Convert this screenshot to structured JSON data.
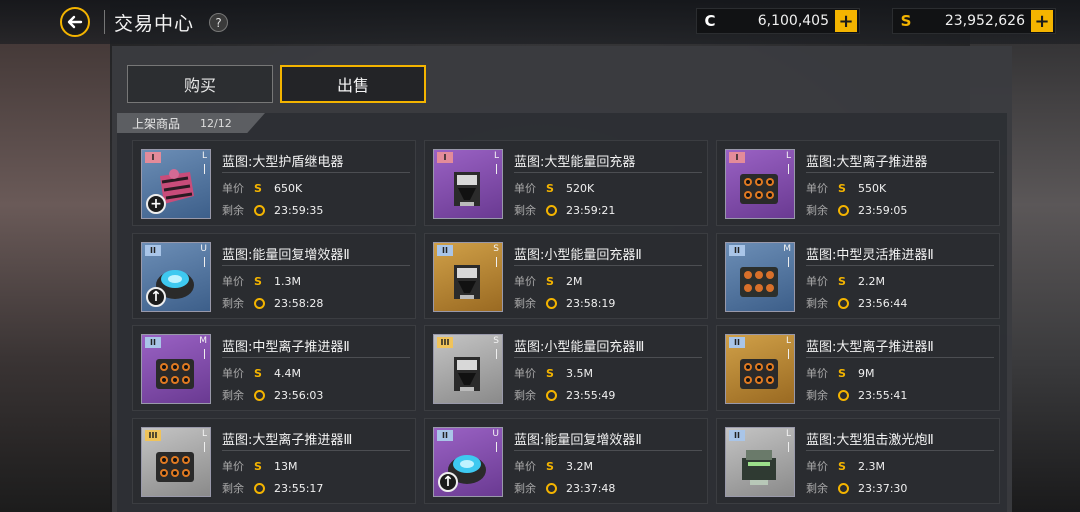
{
  "header": {
    "title": "交易中心",
    "help": "?",
    "currency_c": {
      "symbol": "C",
      "value": "6,100,405",
      "plus": "+"
    },
    "currency_s": {
      "symbol": "S",
      "value": "23,952,626",
      "plus": "+"
    }
  },
  "tabs": {
    "buy": "购买",
    "sell": "出售",
    "active": "sell"
  },
  "listing": {
    "title": "上架商品",
    "count": "12/12"
  },
  "labels": {
    "price": "单价",
    "remaining": "剩余",
    "coin": "S"
  },
  "colors": {
    "accent": "#f4b400"
  },
  "items": [
    {
      "name": "蓝图:大型护盾继电器",
      "price": "650K",
      "time": "23:59:35",
      "tier": "I",
      "slot": "L",
      "rarity": "blue",
      "badge": "+",
      "icon": "shield-relay-icon"
    },
    {
      "name": "蓝图:大型能量回充器",
      "price": "520K",
      "time": "23:59:21",
      "tier": "I",
      "slot": "L",
      "rarity": "purple",
      "badge": "",
      "icon": "energy-recharger-icon"
    },
    {
      "name": "蓝图:大型离子推进器",
      "price": "550K",
      "time": "23:59:05",
      "tier": "I",
      "slot": "L",
      "rarity": "purple",
      "badge": "",
      "icon": "ion-thruster-icon"
    },
    {
      "name": "蓝图:能量回复增效器Ⅱ",
      "price": "1.3M",
      "time": "23:58:28",
      "tier": "II",
      "slot": "U",
      "rarity": "blue",
      "badge": "↑",
      "icon": "energy-booster-icon"
    },
    {
      "name": "蓝图:小型能量回充器Ⅱ",
      "price": "2M",
      "time": "23:58:19",
      "tier": "II",
      "slot": "S",
      "rarity": "orange",
      "badge": "",
      "icon": "energy-recharger-icon"
    },
    {
      "name": "蓝图:中型灵活推进器Ⅱ",
      "price": "2.2M",
      "time": "23:56:44",
      "tier": "II",
      "slot": "M",
      "rarity": "blue",
      "badge": "",
      "icon": "agile-thruster-icon"
    },
    {
      "name": "蓝图:中型离子推进器Ⅱ",
      "price": "4.4M",
      "time": "23:56:03",
      "tier": "II",
      "slot": "M",
      "rarity": "purple",
      "badge": "",
      "icon": "ion-thruster-icon"
    },
    {
      "name": "蓝图:小型能量回充器Ⅲ",
      "price": "3.5M",
      "time": "23:55:49",
      "tier": "III",
      "slot": "S",
      "rarity": "grey",
      "badge": "",
      "icon": "energy-recharger-icon"
    },
    {
      "name": "蓝图:大型离子推进器Ⅱ",
      "price": "9M",
      "time": "23:55:41",
      "tier": "II",
      "slot": "L",
      "rarity": "orange",
      "badge": "",
      "icon": "ion-thruster-icon"
    },
    {
      "name": "蓝图:大型离子推进器Ⅲ",
      "price": "13M",
      "time": "23:55:17",
      "tier": "III",
      "slot": "L",
      "rarity": "grey",
      "badge": "",
      "icon": "ion-thruster-icon"
    },
    {
      "name": "蓝图:能量回复增效器Ⅱ",
      "price": "3.2M",
      "time": "23:37:48",
      "tier": "II",
      "slot": "U",
      "rarity": "purple",
      "badge": "↑",
      "icon": "energy-booster-icon"
    },
    {
      "name": "蓝图:大型狙击激光炮Ⅱ",
      "price": "2.3M",
      "time": "23:37:30",
      "tier": "II",
      "slot": "L",
      "rarity": "grey",
      "badge": "",
      "icon": "sniper-laser-icon"
    }
  ]
}
